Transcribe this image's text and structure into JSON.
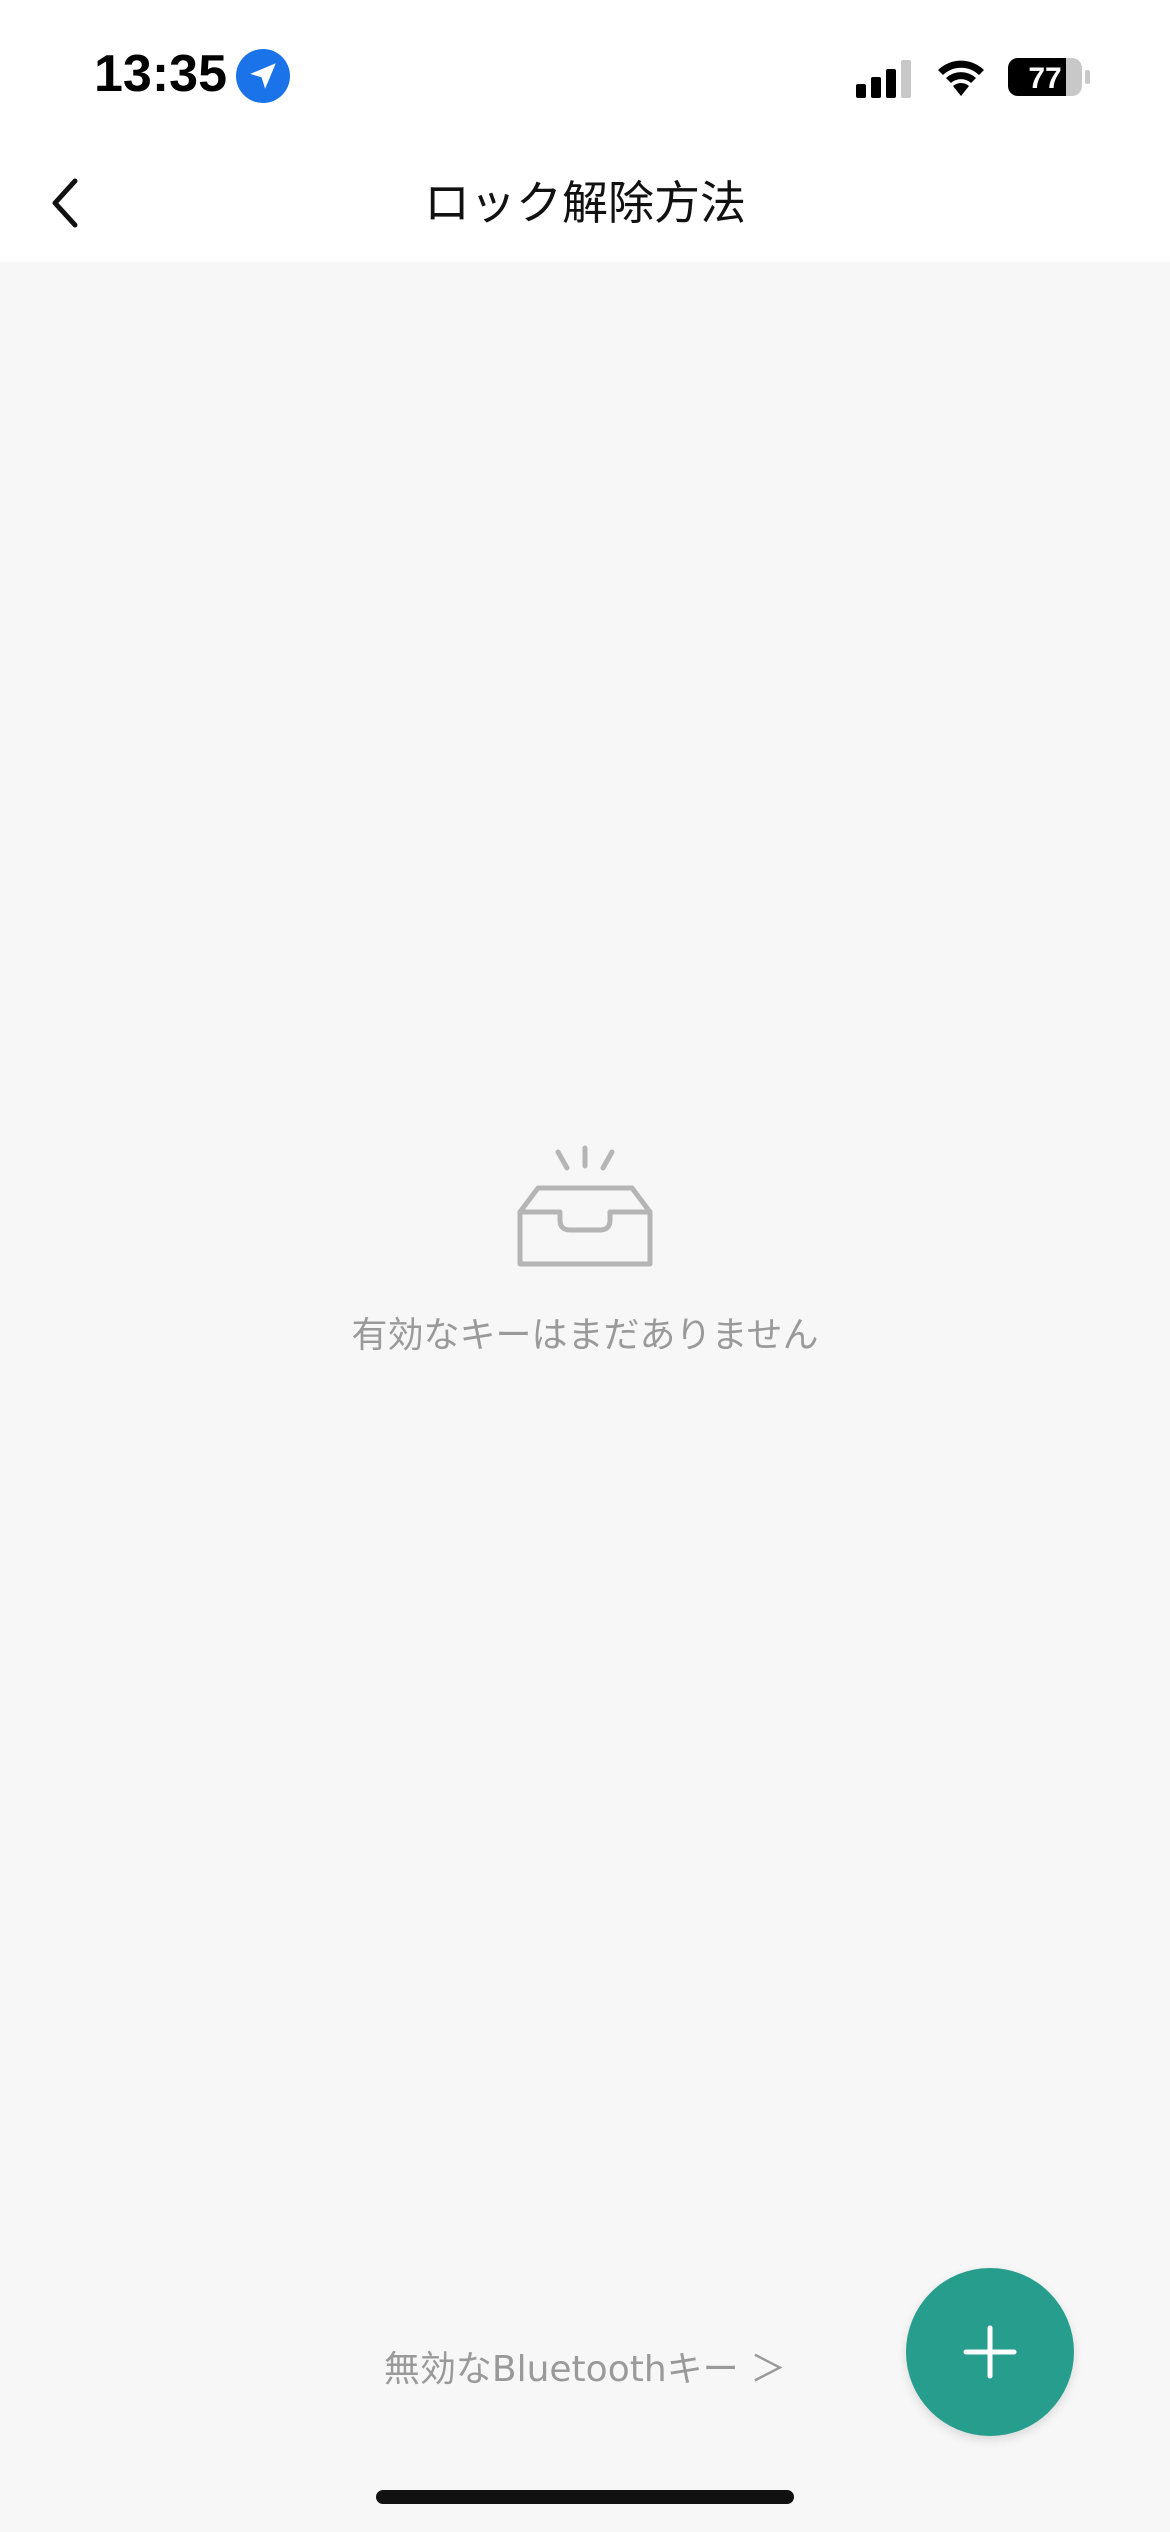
{
  "status_bar": {
    "time": "13:35",
    "battery_level": "77",
    "location_icon": "location-arrow-icon",
    "signal_icon": "cellular-signal-icon",
    "wifi_icon": "wifi-icon",
    "battery_icon": "battery-icon"
  },
  "header": {
    "title": "ロック解除方法",
    "back_icon": "chevron-left-icon"
  },
  "empty_state": {
    "icon": "empty-inbox-icon",
    "message": "有効なキーはまだありません"
  },
  "footer": {
    "invalid_bluetooth_link": "無効なBluetoothキー ＞"
  },
  "fab": {
    "icon": "plus-icon"
  },
  "colors": {
    "accent": "#279e8d",
    "location_blue": "#1a73e8",
    "muted_text": "#9a9a9a",
    "background": "#f7f7f7"
  }
}
